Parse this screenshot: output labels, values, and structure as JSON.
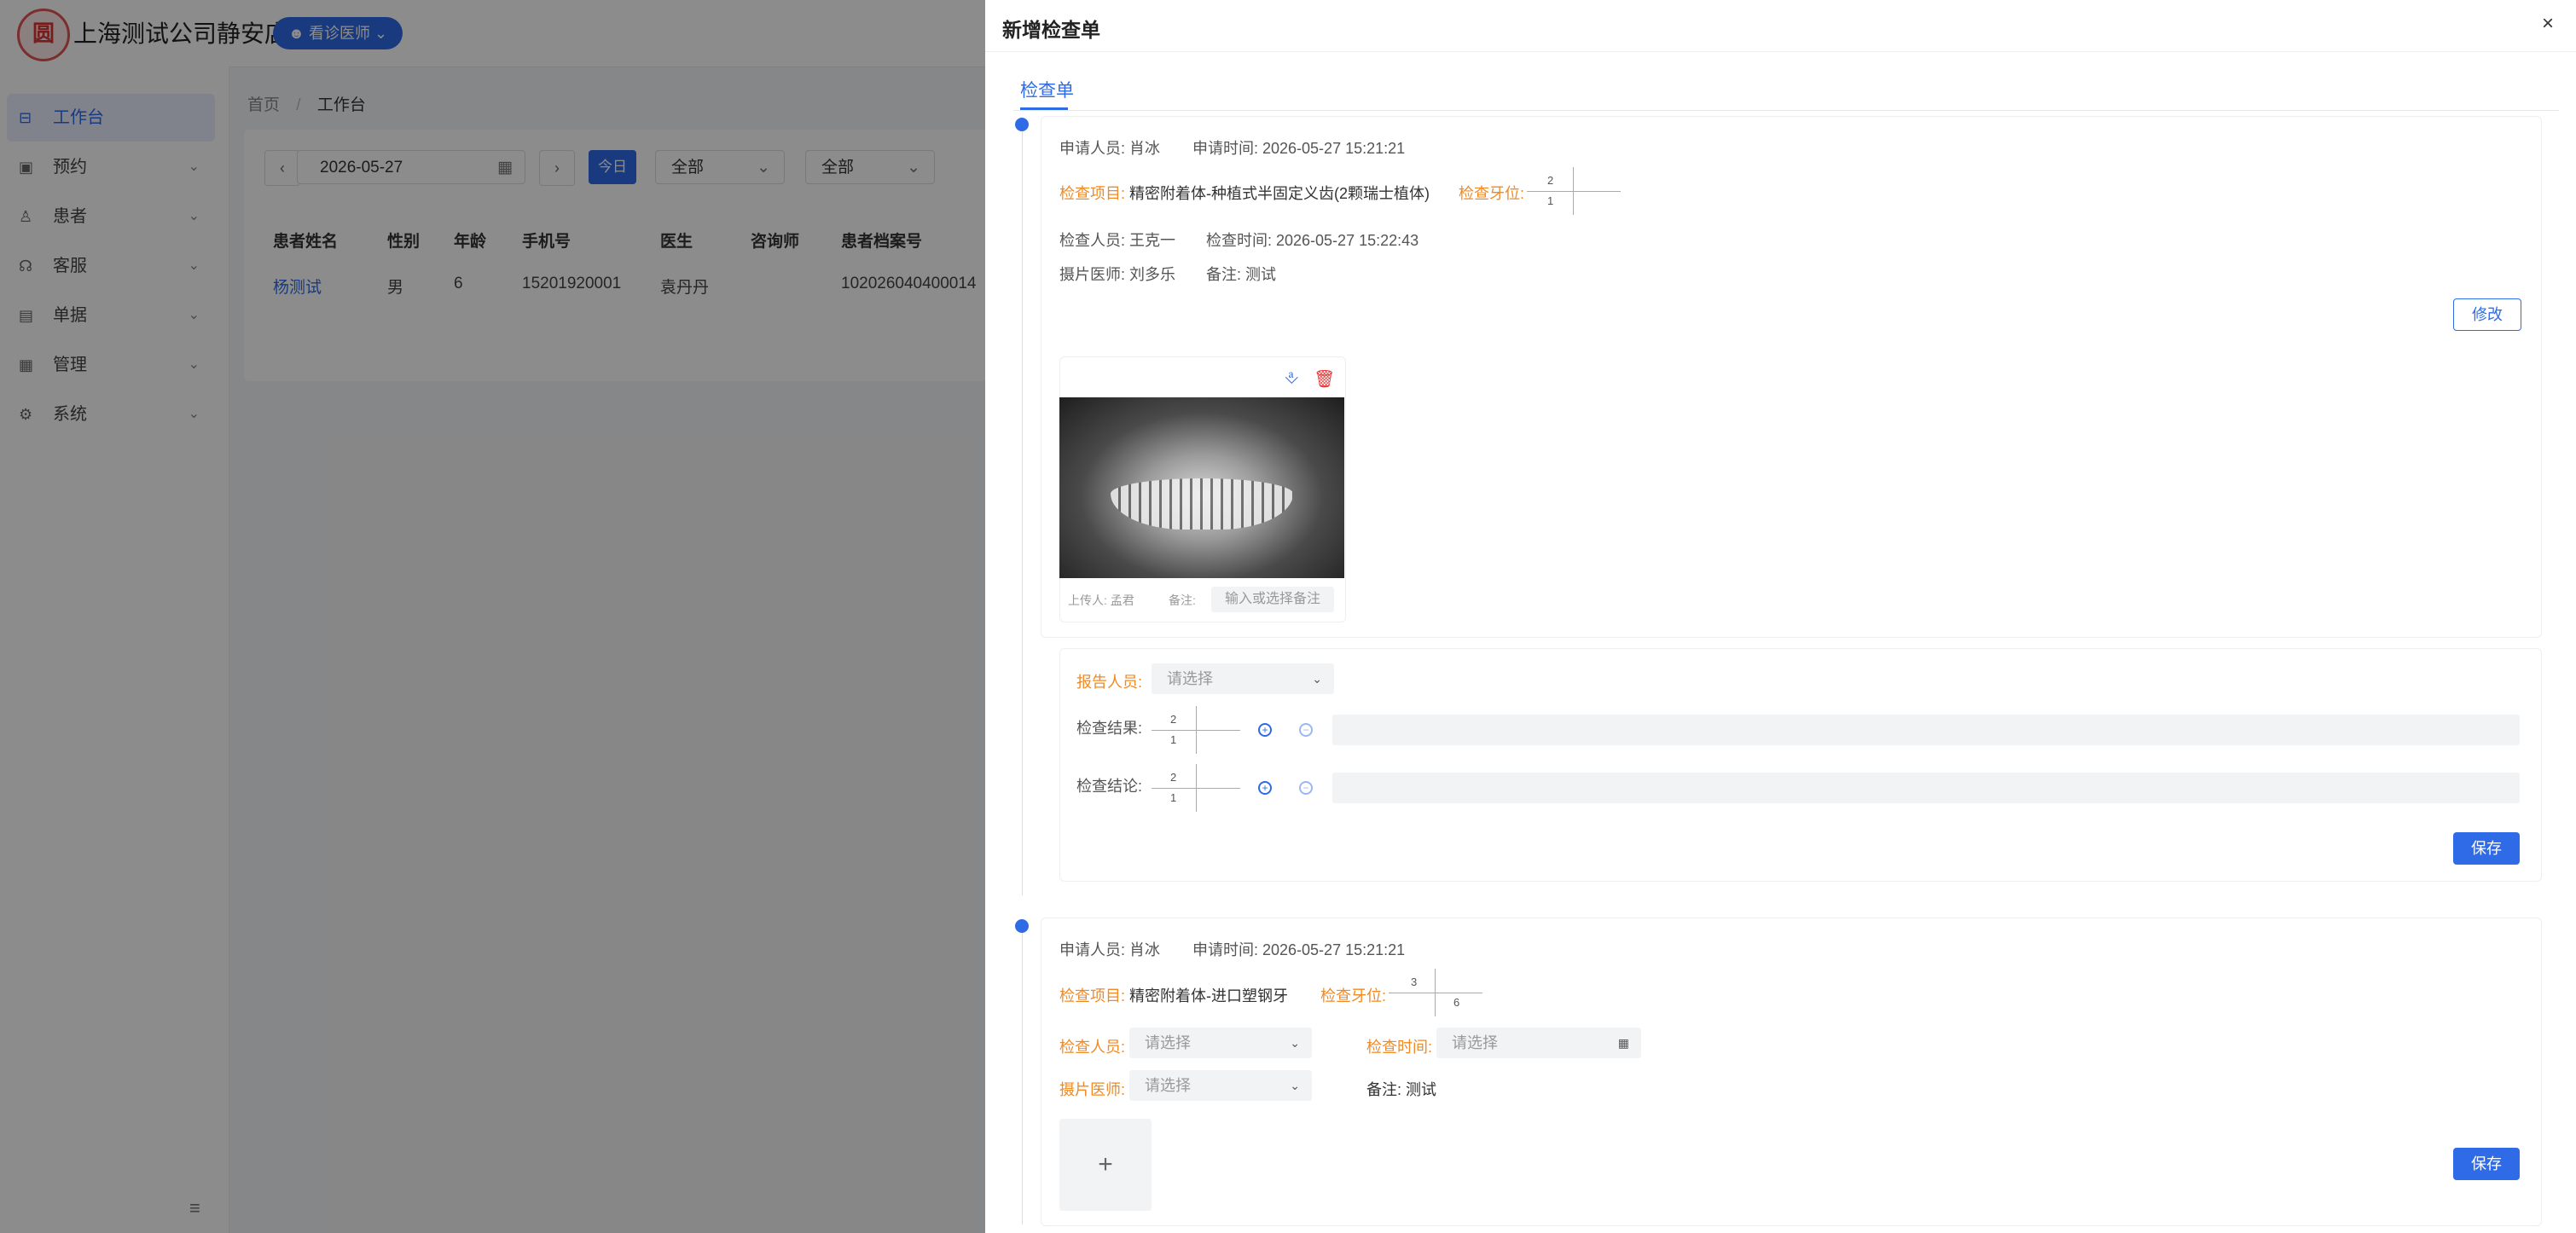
{
  "app": {
    "shop_name": "上海测试公司静安店",
    "logo_char": "圆",
    "role": "看诊医师"
  },
  "sidebar": {
    "items": [
      {
        "label": "工作台",
        "icon": "desk-icon",
        "glyph": "⊟"
      },
      {
        "label": "预约",
        "icon": "calendar-icon",
        "glyph": "▣"
      },
      {
        "label": "患者",
        "icon": "user-icon",
        "glyph": "♙"
      },
      {
        "label": "客服",
        "icon": "headset-icon",
        "glyph": "☊"
      },
      {
        "label": "单据",
        "icon": "document-icon",
        "glyph": "▤"
      },
      {
        "label": "管理",
        "icon": "grid-icon",
        "glyph": "▦"
      },
      {
        "label": "系统",
        "icon": "gear-icon",
        "glyph": "⚙"
      }
    ]
  },
  "breadcrumb": {
    "home": "首页",
    "sep": "/",
    "current": "工作台"
  },
  "filters": {
    "date": "2026-05-27",
    "today": "今日",
    "select1": "全部",
    "select2": "全部"
  },
  "table": {
    "headers": [
      "患者姓名",
      "性别",
      "年龄",
      "手机号",
      "医生",
      "咨询师",
      "患者档案号"
    ],
    "row": [
      "杨测试",
      "男",
      "6",
      "15201920001",
      "袁丹丹",
      "",
      "102026040400014"
    ]
  },
  "drawer": {
    "title": "新增检查单",
    "close": "×",
    "tab": "检查单",
    "exam1": {
      "applicant": "申请人员: 肖冰",
      "apply_time": "申请时间: 2026-05-27 15:21:21",
      "item_label": "检查项目:",
      "item_value": "精密附着体-种植式半固定义齿(2颗瑞士植体)",
      "tooth_label": "检查牙位:",
      "tooth_top": "2",
      "tooth_bottom": "1",
      "examiner": "检查人员: 王克一",
      "exam_time": "检查时间: 2026-05-27 15:22:43",
      "film_doctor": "摄片医师: 刘多乐",
      "remark": "备注: 测试",
      "edit_btn": "修改",
      "image": {
        "uploader_label": "上传人:",
        "uploader": "孟君",
        "remark_label": "备注:",
        "remark_placeholder": "输入或选择备注"
      },
      "report": {
        "reporter_label": "报告人员:",
        "reporter_placeholder": "请选择",
        "result_label": "检查结果:",
        "result_top": "2",
        "result_bottom": "1",
        "conclusion_label": "检查结论:",
        "conclusion_top": "2",
        "conclusion_bottom": "1",
        "save_btn": "保存"
      }
    },
    "exam2": {
      "applicant": "申请人员: 肖冰",
      "apply_time": "申请时间: 2026-05-27 15:21:21",
      "item_label": "检查项目:",
      "item_value": "精密附着体-进口塑钢牙",
      "tooth_label": "检查牙位:",
      "tooth_top": "3",
      "tooth_bottom": "6",
      "examiner_label": "检查人员:",
      "examiner_placeholder": "请选择",
      "exam_time_label": "检查时间:",
      "exam_time_placeholder": "请选择",
      "film_label": "摄片医师:",
      "film_placeholder": "请选择",
      "remark": "备注: 测试",
      "upload_plus": "+",
      "save_btn": "保存"
    }
  }
}
